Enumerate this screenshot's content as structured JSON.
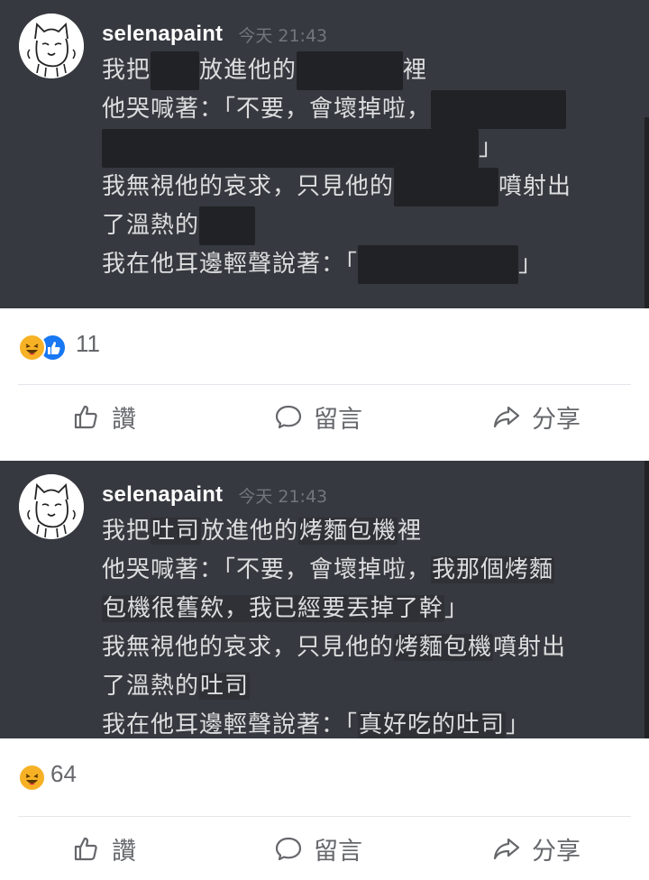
{
  "posts": [
    {
      "username": "selenapaint",
      "timestamp": "今天 21:43",
      "lines": {
        "l1a": "我把",
        "l1b": "放進他的",
        "l1c": "裡",
        "l2": "他哭喊著：「不要，會壞掉啦，",
        "l3": "」",
        "l4a": "我無視他的哀求，只見他的",
        "l4b": "噴射出",
        "l5": "了溫熱的",
        "l6a": "我在他耳邊輕聲說著：「",
        "l6b": "」"
      },
      "reaction_count": "11",
      "reaction_types": [
        "haha-icon",
        "like-icon"
      ]
    },
    {
      "username": "selenapaint",
      "timestamp": "今天 21:43",
      "lines": {
        "l1a": "我把",
        "l1b": "吐司",
        "l1c": "放進他的",
        "l1d": "烤麵包機",
        "l1e": "裡",
        "l2a": "他哭喊著：「不要，會壞掉啦，",
        "l2b": "我那個烤麵",
        "l3a": "包機很舊欸，我已經要丟掉了幹",
        "l3b": "」",
        "l4a": "我無視他的哀求，只見他的",
        "l4b": "烤麵包機",
        "l4c": "噴射出",
        "l5a": "了溫熱的",
        "l5b": "吐司",
        "l6a": "我在他耳邊輕聲說著：「",
        "l6b": "真好吃的吐司",
        "l6c": "」"
      },
      "reaction_count": "64",
      "reaction_types": [
        "haha-icon"
      ]
    }
  ],
  "actions": {
    "like": "讚",
    "comment": "留言",
    "share": "分享"
  },
  "colors": {
    "chat_bg": "#36393f",
    "spoiler": "#202225",
    "text": "#dcddde",
    "timestamp": "#72767d",
    "fb_gray": "#65676b",
    "haha": "#f7b125",
    "like": "#1877f2"
  }
}
